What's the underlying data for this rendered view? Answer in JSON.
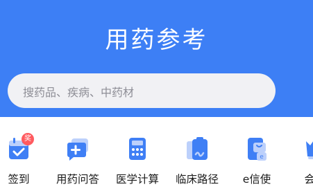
{
  "header": {
    "title": "用药参考"
  },
  "search": {
    "placeholder": "搜药品、疾病、中药材"
  },
  "tools": [
    {
      "label": "签到",
      "icon": "calendar-checkin-icon",
      "badge": "奖"
    },
    {
      "label": "用药问答",
      "icon": "chat-plus-icon"
    },
    {
      "label": "医学计算",
      "icon": "calculator-icon"
    },
    {
      "label": "临床路径",
      "icon": "clipboard-path-icon"
    },
    {
      "label": "e信使",
      "icon": "messenger-phone-icon"
    },
    {
      "label": "会员",
      "icon": "member-icon"
    }
  ],
  "colors": {
    "banner": "#3d7ff5",
    "icon_light": "#bcd0fb",
    "icon_dark": "#3f7ff5",
    "badge": "#ff5a5f"
  }
}
